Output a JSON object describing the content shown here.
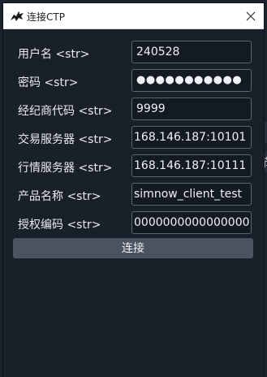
{
  "window": {
    "title": "连接CTP",
    "icon": "app-logo-icon",
    "close_icon": "close-icon"
  },
  "form": {
    "fields": [
      {
        "label": "用户名 <str>",
        "value": "240528"
      },
      {
        "label": "密码 <str>",
        "value": "●●●●●●●●●●●"
      },
      {
        "label": "经纪商代码 <str>",
        "value": "9999"
      },
      {
        "label": "交易服务器 <str>",
        "value": "168.146.187:10101"
      },
      {
        "label": "行情服务器 <str>",
        "value": "168.146.187:10111"
      },
      {
        "label": "产品名称 <str>",
        "value": "simnow_client_test"
      },
      {
        "label": "授权编码 <str>",
        "value": "0000000000000000"
      }
    ],
    "submit_label": "连接"
  },
  "background": {
    "partial_char": "栉"
  },
  "colors": {
    "background": "#1b212b",
    "dialog": "#19202a",
    "field_border": "#5c6470",
    "button": "#4b5360",
    "text": "#e8ebef"
  }
}
